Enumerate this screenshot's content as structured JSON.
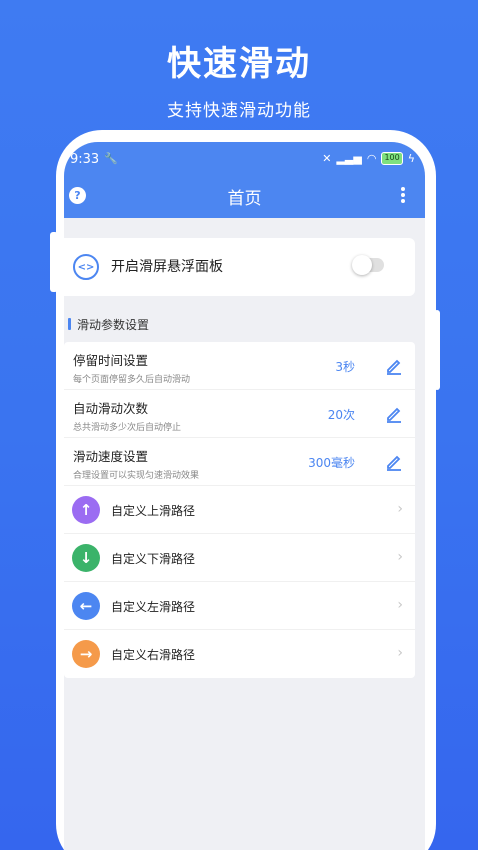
{
  "promo": {
    "title": "快速滑动",
    "subtitle": "支持快速滑动功能"
  },
  "status_bar": {
    "time": "9:33",
    "battery": "100"
  },
  "app_bar": {
    "title": "首页",
    "help_icon": "help-circle-icon",
    "menu_icon": "more-vertical-icon"
  },
  "floating_panel": {
    "label": "开启滑屏悬浮面板",
    "enabled": false
  },
  "section": {
    "title": "滑动参数设置"
  },
  "settings": [
    {
      "title": "停留时间设置",
      "desc": "每个页面停留多久后自动滑动",
      "value": "3秒"
    },
    {
      "title": "自动滑动次数",
      "desc": "总共滑动多少次后自动停止",
      "value": "20次"
    },
    {
      "title": "滑动速度设置",
      "desc": "合理设置可以实现匀速滑动效果",
      "value": "300毫秒"
    }
  ],
  "paths": [
    {
      "label": "自定义上滑路径",
      "icon": "arrow-up-icon",
      "color": "#9b6cf2"
    },
    {
      "label": "自定义下滑路径",
      "icon": "arrow-down-icon",
      "color": "#3bb36a"
    },
    {
      "label": "自定义左滑路径",
      "icon": "arrow-left-icon",
      "color": "#4c86f1"
    },
    {
      "label": "自定义右滑路径",
      "icon": "arrow-right-icon",
      "color": "#f59a4a"
    }
  ],
  "colors": {
    "accent": "#4c86f1",
    "background": "#3a74f0"
  }
}
